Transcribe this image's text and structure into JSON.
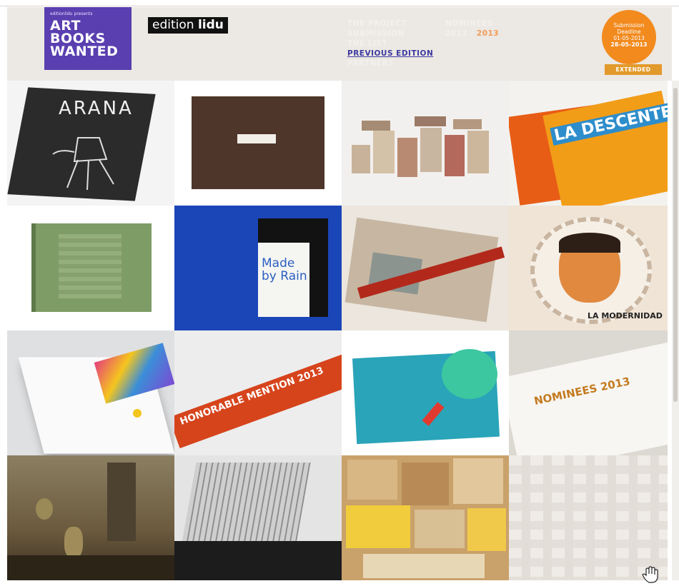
{
  "header": {
    "presents_line": "editionlidu presents",
    "logo_lines": [
      "ART",
      "BOOKS",
      "WANTED"
    ],
    "edition_left": "edition",
    "edition_right": "lidu",
    "nav": [
      {
        "label": "THE PROJECT",
        "active": false
      },
      {
        "label": "SUBMISSION",
        "active": false
      },
      {
        "label": "THE LIST",
        "active": false
      },
      {
        "label": "PREVIOUS EDITION",
        "active": true
      },
      {
        "label": "PARTNERS",
        "active": false
      }
    ],
    "nominees_label": "NOMINEES",
    "year_a": "2012",
    "year_sep": "/",
    "year_b": "2013"
  },
  "badge": {
    "line1": "Submission",
    "line2": "Deadline",
    "old_date": "01-05-2013",
    "new_date": "28-05-2013",
    "ribbon": "EXTENDED"
  },
  "tiles": [
    {
      "name": "arana",
      "title": "ARANA"
    },
    {
      "name": "brown-book",
      "title": ""
    },
    {
      "name": "paper-cutouts",
      "title": ""
    },
    {
      "name": "la-descente",
      "title": "LA DESCENTE"
    },
    {
      "name": "green-book",
      "title": ""
    },
    {
      "name": "made-by-rain",
      "title": "Made by Rain"
    },
    {
      "name": "red-string-book",
      "title": ""
    },
    {
      "name": "frida-book",
      "title": "LA MODERNIDAD"
    },
    {
      "name": "white-book",
      "title": ""
    },
    {
      "name": "honorable-mention",
      "title": "HONORABLE MENTION 2013"
    },
    {
      "name": "rabbits-book",
      "title": ""
    },
    {
      "name": "nominees-2013",
      "title": "NOMINEES 2013"
    },
    {
      "name": "machinarium",
      "title": ""
    },
    {
      "name": "paper-building",
      "title": ""
    },
    {
      "name": "packages",
      "title": ""
    },
    {
      "name": "faded-grid",
      "title": ""
    }
  ],
  "colors": {
    "logo_purple": "#5a3fb0",
    "header_bg": "#ece8e3",
    "badge_orange": "#f28a1e",
    "nav_active": "#3d3aa0"
  }
}
